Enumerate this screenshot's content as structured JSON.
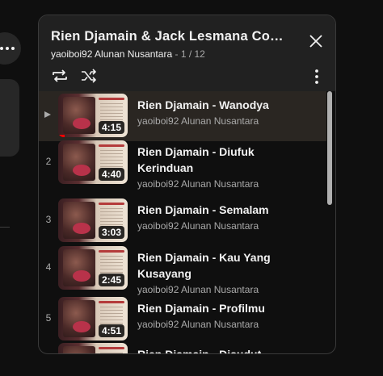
{
  "playlist": {
    "title": "Rien Djamain & Jack Lesmana Comb…",
    "owner": "yaoiboi92 Alunan Nusantara",
    "separator": "-",
    "position": "1 / 12"
  },
  "icons": {
    "close": "close-icon",
    "loop": "loop-icon",
    "shuffle": "shuffle-icon",
    "menu": "more-vert-icon",
    "playing": "play-indicator-icon"
  },
  "colors": {
    "active_row": "#2a2622",
    "progress": "#ff0000"
  },
  "items": [
    {
      "index": "",
      "title": "Rien Djamain - Wanodya",
      "channel": "yaoiboi92 Alunan Nusantara",
      "duration": "4:15",
      "active": true
    },
    {
      "index": "2",
      "title": "Rien Djamain - Diufuk Kerinduan",
      "channel": "yaoiboi92 Alunan Nusantara",
      "duration": "4:40"
    },
    {
      "index": "3",
      "title": "Rien Djamain - Semalam",
      "channel": "yaoiboi92 Alunan Nusantara",
      "duration": "3:03"
    },
    {
      "index": "4",
      "title": "Rien Djamain - Kau Yang Kusayang",
      "channel": "yaoiboi92 Alunan Nusantara",
      "duration": "2:45"
    },
    {
      "index": "5",
      "title": "Rien Djamain - Profilmu",
      "channel": "yaoiboi92 Alunan Nusantara",
      "duration": "4:51"
    },
    {
      "index": "",
      "title": "Rien Djamain - Disudut Kerling",
      "channel": "",
      "duration": ""
    }
  ]
}
